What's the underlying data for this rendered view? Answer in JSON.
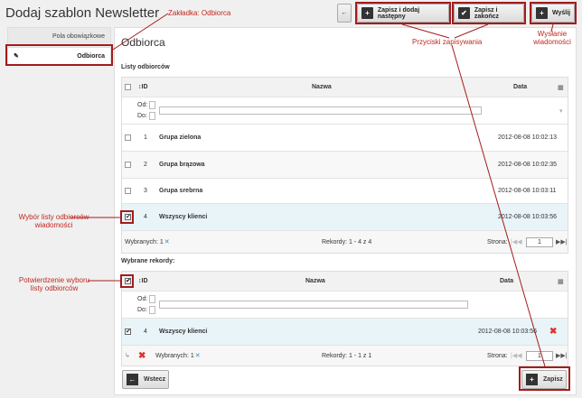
{
  "header": {
    "title": "Dodaj szablon Newsletter"
  },
  "toolbar": {
    "back_icon": "←",
    "save_add_label": "Zapisz i dodaj następny",
    "save_close_label": "Zapisz i zakończ",
    "send_label": "Wyślij"
  },
  "sidebar": {
    "items": [
      {
        "label": "Pola obowiązkowe"
      },
      {
        "label": "Odbiorca"
      }
    ]
  },
  "main": {
    "heading": "Odbiorca"
  },
  "lists": {
    "section_label": "Listy odbiorców",
    "columns": {
      "id": "ID",
      "name": "Nazwa",
      "date": "Data"
    },
    "filter": {
      "from_label": "Od:",
      "to_label": "Do:"
    },
    "rows": [
      {
        "id": "1",
        "name": "Grupa zielona",
        "date": "2012-08-08 10:02:13",
        "checked": false
      },
      {
        "id": "2",
        "name": "Grupa brązowa",
        "date": "2012-08-08 10:02:35",
        "checked": false
      },
      {
        "id": "3",
        "name": "Grupa srebrna",
        "date": "2012-08-08 10:03:11",
        "checked": false
      },
      {
        "id": "4",
        "name": "Wszyscy klienci",
        "date": "2012-08-08 10:03:56",
        "checked": true
      }
    ],
    "footer": {
      "selected": "Wybranych: 1",
      "records": "Rekordy: 1 - 4 z 4",
      "page_label": "Strona:",
      "page_value": "1"
    }
  },
  "selected": {
    "section_label": "Wybrane rekordy:",
    "columns": {
      "id": "ID",
      "name": "Nazwa",
      "date": "Data"
    },
    "filter": {
      "from_label": "Od:",
      "to_label": "Do:"
    },
    "rows": [
      {
        "id": "4",
        "name": "Wszyscy klienci",
        "date": "2012-08-08 10:03:56",
        "checked": true
      }
    ],
    "footer": {
      "selected": "Wybranych: 1",
      "records": "Rekordy: 1 - 1 z 1",
      "page_label": "Strona:",
      "page_value": "1"
    }
  },
  "bottom": {
    "back_label": "Wstecz",
    "save_label": "Zapisz"
  },
  "annotations": {
    "tab": "Zakładka: Odbiorca",
    "save_buttons": "Przyciski zapisywania",
    "send_line1": "Wysłanie",
    "send_line2": "wiadomości",
    "choose_line1": "Wybór listy odbiorców",
    "choose_line2": "wiadomości",
    "confirm_line1": "Potwierdzenie wyboru",
    "confirm_line2": "listy odbiorców"
  },
  "colors": {
    "annotation": "#c0281f",
    "annotation_box": "#a31c1c",
    "selected_row": "#e8f4f8"
  }
}
